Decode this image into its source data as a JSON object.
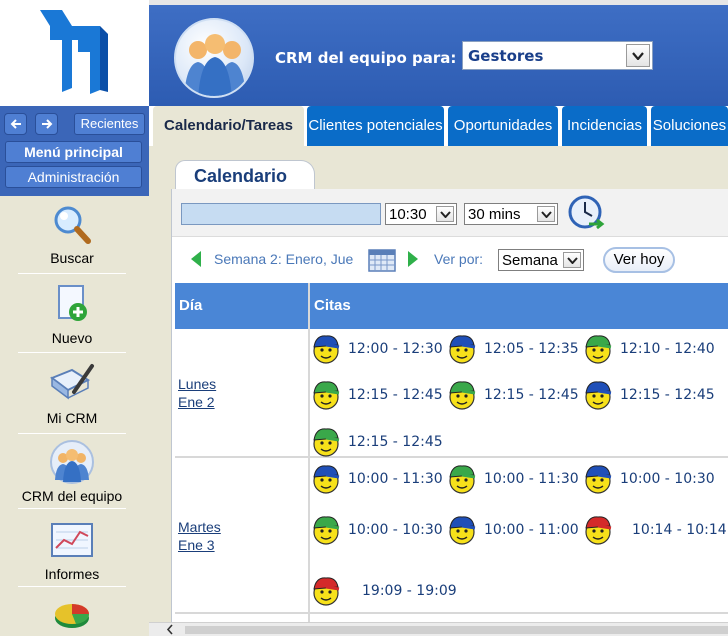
{
  "header": {
    "label": "CRM del equipo para:",
    "team_selected": "Gestores"
  },
  "sidebar": {
    "recientes": "Recientes",
    "menu_principal": "Menú principal",
    "administracion": "Administración",
    "items": [
      {
        "label": "Buscar",
        "icon": "magnifier-icon"
      },
      {
        "label": "Nuevo",
        "icon": "new-document-icon"
      },
      {
        "label": "Mi CRM",
        "icon": "notebook-pen-icon"
      },
      {
        "label": "CRM del equipo",
        "icon": "team-icon"
      },
      {
        "label": "Informes",
        "icon": "chart-report-icon"
      },
      {
        "label": "",
        "icon": "pie-chart-icon"
      }
    ]
  },
  "tabs": [
    {
      "label": "Calendario/Tareas",
      "active": true
    },
    {
      "label": "Clientes potenciales",
      "active": false
    },
    {
      "label": "Oportunidades",
      "active": false
    },
    {
      "label": "Incidencias",
      "active": false
    },
    {
      "label": "Soluciones",
      "active": false
    }
  ],
  "calendar": {
    "title": "Calendario",
    "time_value": "10:30",
    "duration_value": "30 mins",
    "week_label": "Semana 2: Enero, Jue",
    "ver_por_label": "Ver por:",
    "view_value": "Semana",
    "ver_hoy": "Ver hoy",
    "col_day": "Día",
    "col_appointments": "Citas",
    "days": [
      {
        "name": "Lunes",
        "date": "Ene 2",
        "appointments": [
          {
            "time": "12:00 - 12:30",
            "cap": "blue"
          },
          {
            "time": "12:05 - 12:35",
            "cap": "blue"
          },
          {
            "time": "12:10 - 12:40",
            "cap": "green"
          },
          {
            "time": "12:15 - 12:45",
            "cap": "green"
          },
          {
            "time": "12:15 - 12:45",
            "cap": "green"
          },
          {
            "time": "12:15 - 12:45",
            "cap": "blue"
          },
          {
            "time": "12:15 - 12:45",
            "cap": "green"
          }
        ]
      },
      {
        "name": "Martes",
        "date": "Ene 3",
        "appointments": [
          {
            "time": "10:00 - 11:30",
            "cap": "blue"
          },
          {
            "time": "10:00 - 11:30",
            "cap": "green"
          },
          {
            "time": "10:00 - 10:30",
            "cap": "blue"
          },
          {
            "time": "10:00 - 10:30",
            "cap": "green"
          },
          {
            "time": "10:00 - 11:00",
            "cap": "blue"
          },
          {
            "time": "10:14 - 10:14",
            "cap": "red"
          },
          {
            "time": "19:09 - 19:09",
            "cap": "red"
          }
        ]
      }
    ]
  },
  "colors": {
    "header_blue": "#2d5cb2",
    "tab_blue": "#0a6cc8",
    "table_header": "#4a86d6",
    "sidebar_bg": "#e8e6d5",
    "cap_blue": "#1f4fb8",
    "cap_green": "#3aa84a",
    "cap_red": "#d42a2a"
  }
}
